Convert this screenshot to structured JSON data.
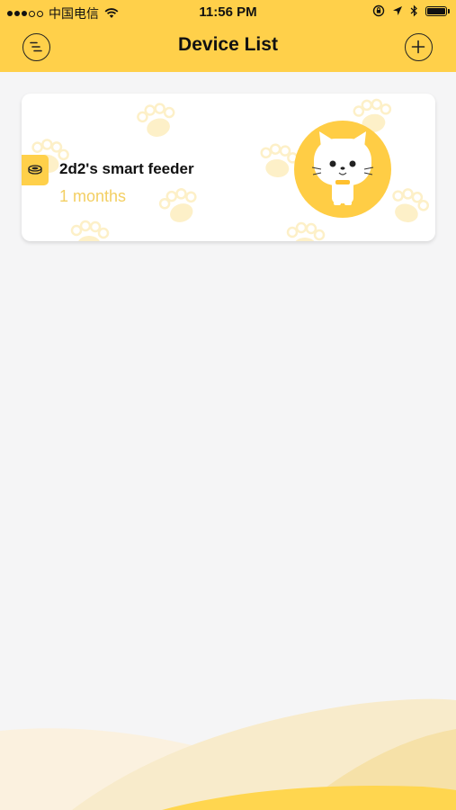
{
  "status_bar": {
    "carrier": "中国电信",
    "time": "11:56 PM"
  },
  "header": {
    "title": "Device List",
    "menu_icon": "menu-lines-icon",
    "add_icon": "plus-icon"
  },
  "devices": [
    {
      "name": "2d2's smart feeder",
      "age": "1 months",
      "type_icon": "feeder-bowl-icon",
      "avatar_icon": "cat-avatar-icon"
    }
  ],
  "colors": {
    "accent": "#ffd04a",
    "age_text": "#f3cf63",
    "background": "#f5f5f6",
    "card": "#ffffff"
  }
}
